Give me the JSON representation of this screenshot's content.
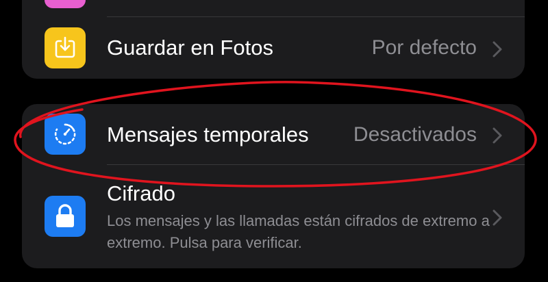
{
  "colors": {
    "background": "#000000",
    "card": "#1c1c1e",
    "separator": "#38383a",
    "label": "#ffffff",
    "secondary": "#8e8e93",
    "pink_icon": "#e85fd0",
    "yellow_icon": "#f7c51c",
    "blue_icon": "#1d7cf2",
    "annotation": "#e0141e"
  },
  "settings": {
    "save_photos": {
      "label": "Guardar en Fotos",
      "value": "Por defecto",
      "icon": "download-icon"
    },
    "disappearing": {
      "label": "Mensajes temporales",
      "value": "Desactivados",
      "icon": "timer-icon"
    },
    "encryption": {
      "label": "Cifrado",
      "description": "Los mensajes y las llamadas están cifrados de extremo a extremo. Pulsa para verificar.",
      "icon": "lock-icon"
    }
  }
}
